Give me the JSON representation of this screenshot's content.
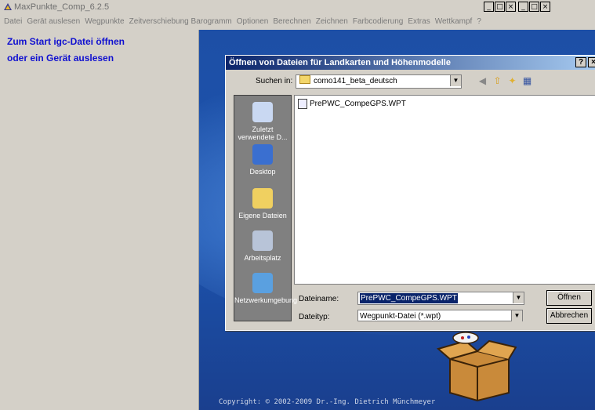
{
  "app": {
    "title": "MaxPunkte_Comp_6.2.5",
    "win_buttons": [
      "_",
      "□",
      "×"
    ]
  },
  "menu": [
    "Datei",
    "Gerät auslesen",
    "Wegpunkte",
    "Zeitverschiebung Barogramm",
    "Optionen",
    "Berechnen",
    "Zeichnen",
    "Farbcodierung",
    "Extras",
    "Wettkampf",
    "?"
  ],
  "left_panel": {
    "line1": "Zum Start igc-Datei öffnen",
    "line2": "oder ein Gerät auslesen"
  },
  "map": {
    "copyright": "Copyright: © 2002-2009  Dr.-Ing. Dietrich Münchmeyer"
  },
  "dialog": {
    "title": "Öffnen von Dateien für Landkarten und Höhenmodelle",
    "help": "?",
    "close": "×",
    "lookin_label": "Suchen in:",
    "lookin_value": "como141_beta_deutsch",
    "places": [
      "Zuletzt verwendete D...",
      "Desktop",
      "Eigene Dateien",
      "Arbeitsplatz",
      "Netzwerkumgebung"
    ],
    "files": [
      "PrePWC_CompeGPS.WPT"
    ],
    "filename_label": "Dateiname:",
    "filename_value": "PrePWC_CompeGPS.WPT",
    "filetype_label": "Dateityp:",
    "filetype_value": "Wegpunkt-Datei (*.wpt)",
    "open_button": "Öffnen",
    "cancel_button": "Abbrechen"
  },
  "colors": {
    "accent": "#0a246a",
    "link_blue": "#1010d0",
    "map_blue": "#1c53ad"
  }
}
